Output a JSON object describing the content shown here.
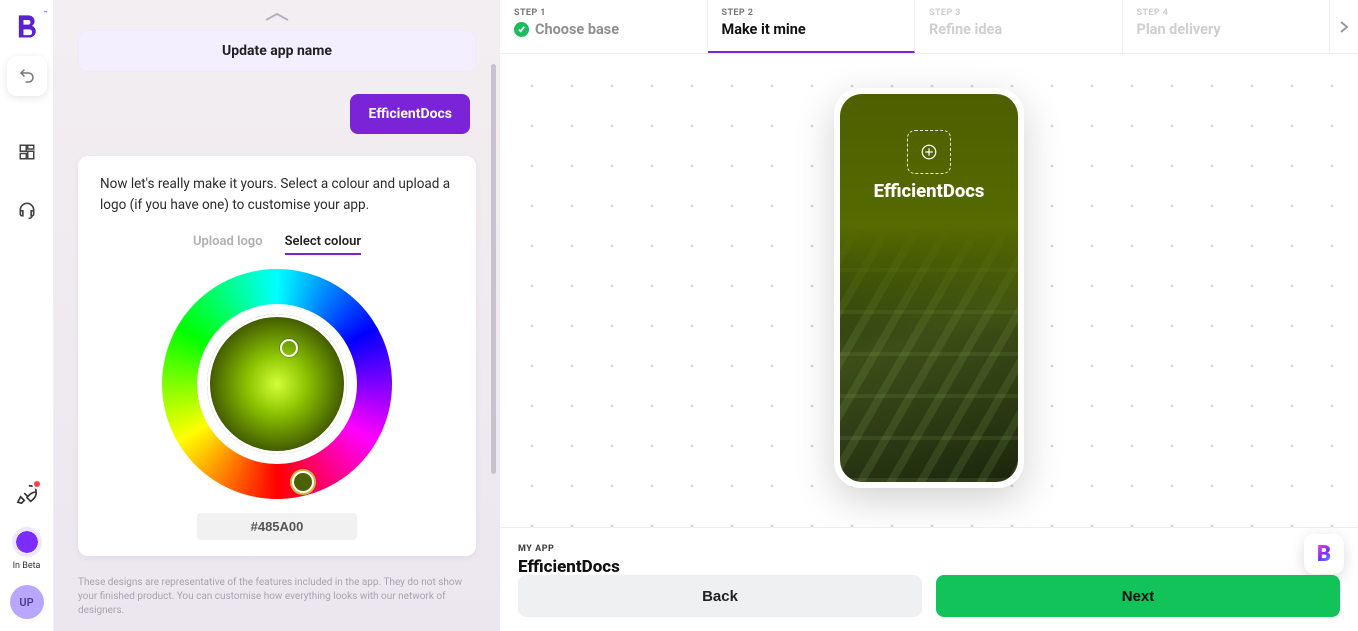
{
  "brand": {
    "trademark": "™"
  },
  "rail": {
    "beta_label": "In Beta",
    "avatar_initials": "UP"
  },
  "mid": {
    "update_label": "Update app name",
    "app_tag": "EfficientDocs",
    "card_desc": "Now let's really make it yours. Select a colour and upload a logo (if you have one) to customise your app.",
    "tab_upload": "Upload logo",
    "tab_colour": "Select colour",
    "hex_value": "#485A00",
    "disclaimer": "These designs are representative of the features included in the app. They do not show your finished product. You can customise how everything looks with our network of designers."
  },
  "steps": {
    "s1": {
      "small": "STEP 1",
      "title": "Choose base"
    },
    "s2": {
      "small": "STEP 2",
      "title": "Make it mine"
    },
    "s3": {
      "small": "STEP 3",
      "title": "Refine idea"
    },
    "s4": {
      "small": "STEP 4",
      "title": "Plan delivery"
    }
  },
  "phone": {
    "title": "EfficientDocs"
  },
  "bottom": {
    "myapp_label": "MY APP",
    "myapp_name": "EfficientDocs",
    "back": "Back",
    "next": "Next"
  }
}
